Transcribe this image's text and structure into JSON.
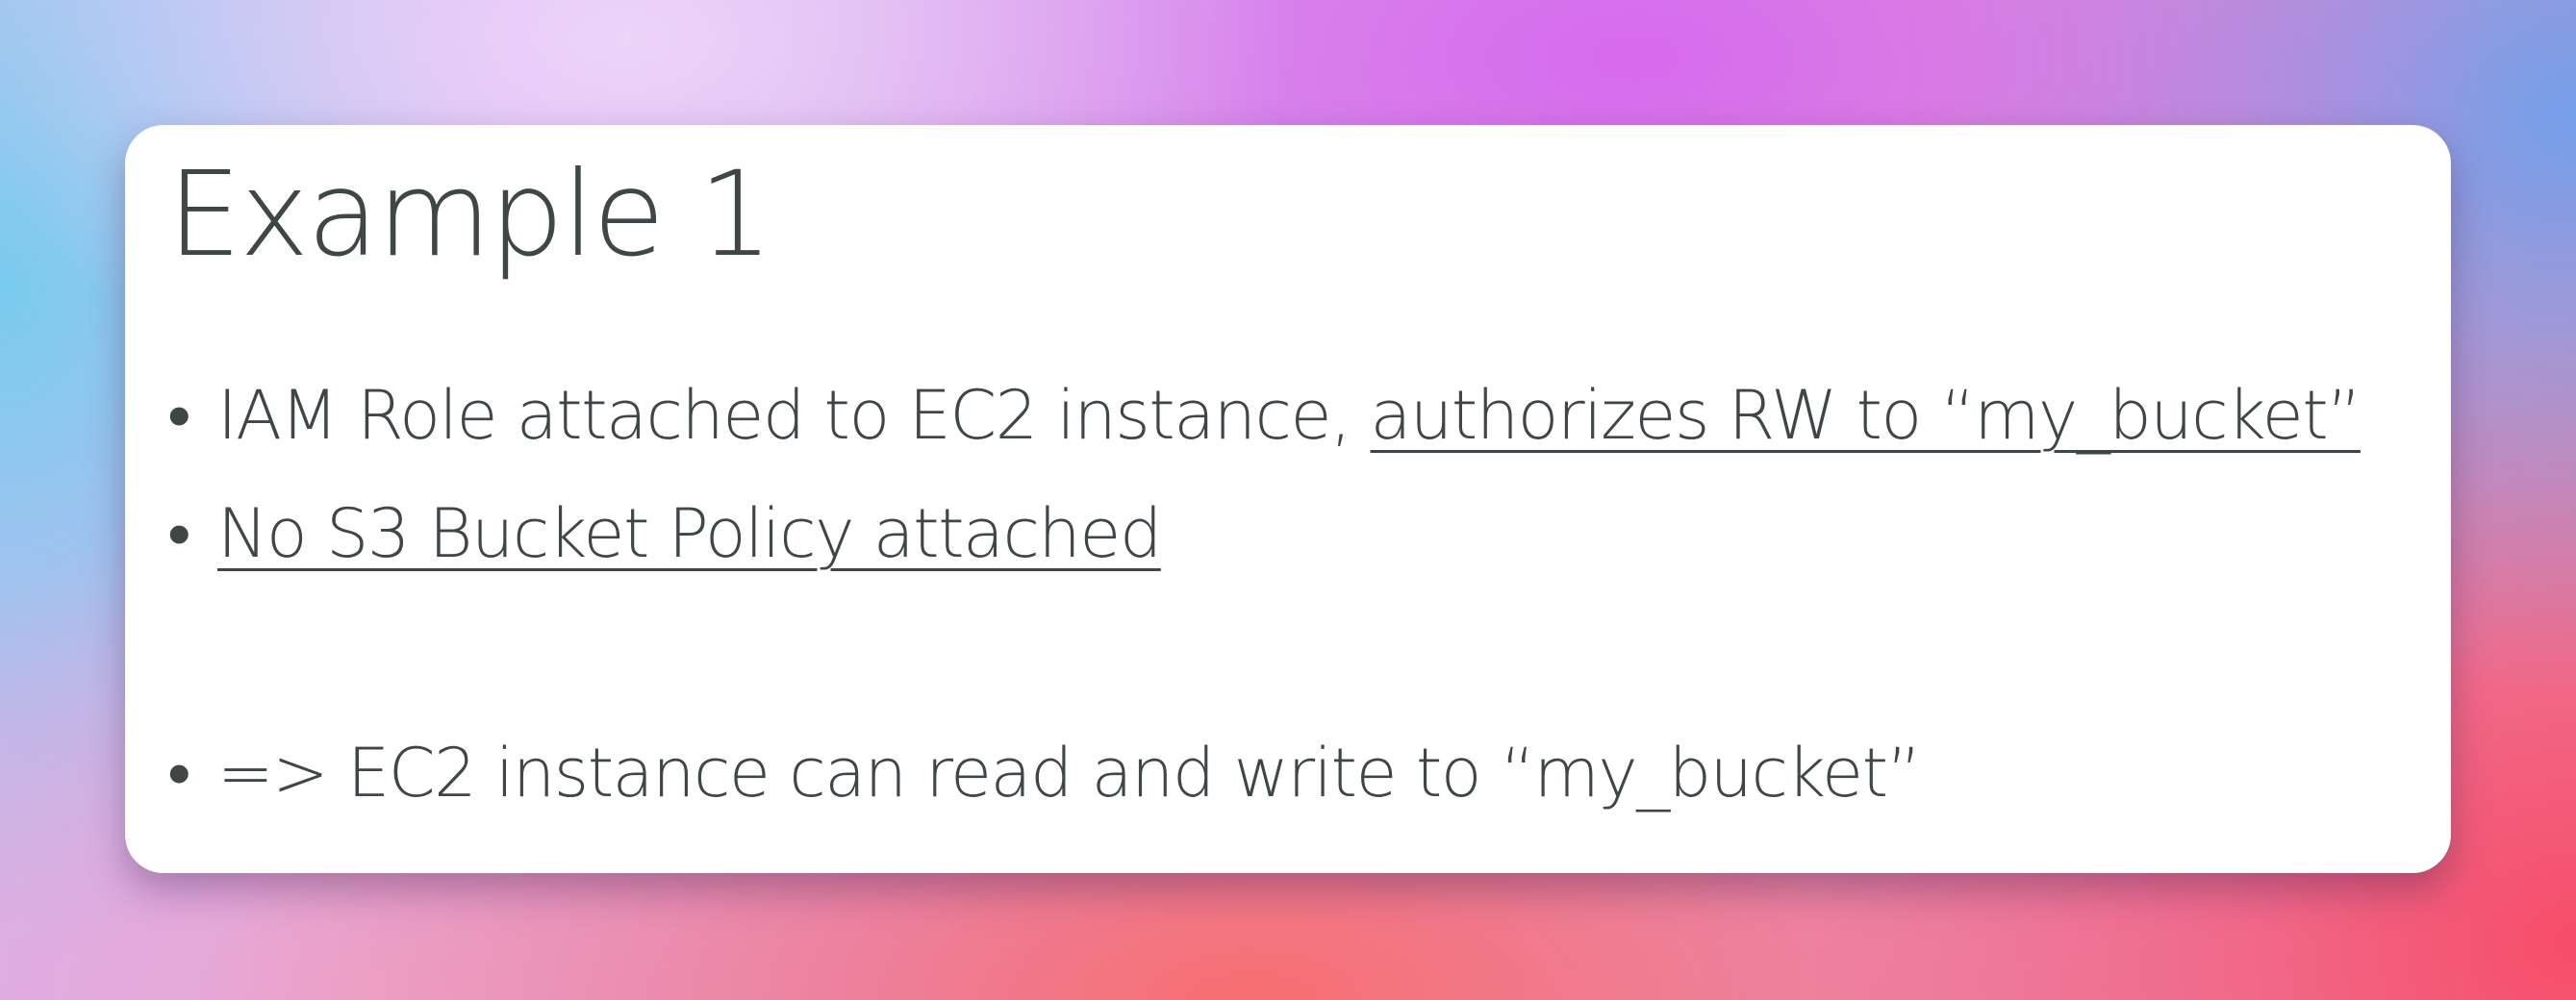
{
  "slide": {
    "title": "Example 1",
    "bullets": [
      {
        "marker": "•",
        "text": "IAM Role attached to EC2 instance, ",
        "underlined": "authorizes RW to “my_bucket”"
      },
      {
        "marker": "•",
        "text": "",
        "underlined": "No S3 Bucket Policy attached"
      },
      {
        "marker": "•",
        "text": "=> EC2 instance can read and write to “my_bucket”",
        "underlined": ""
      }
    ]
  },
  "colors": {
    "text": "#3f4646",
    "card": "#ffffff"
  }
}
